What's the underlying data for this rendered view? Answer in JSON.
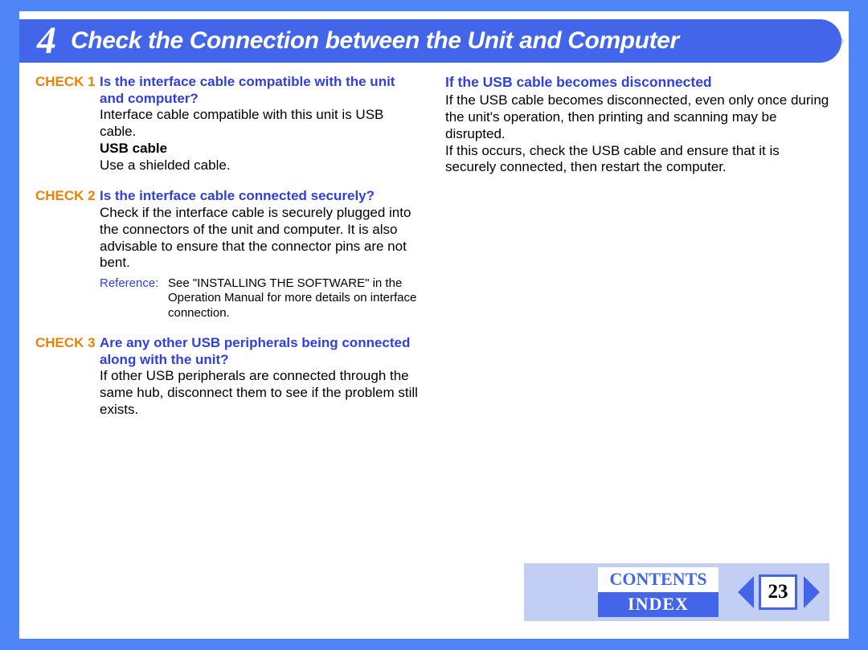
{
  "header": {
    "number": "4",
    "title": "Check the Connection between the Unit and Computer"
  },
  "left": {
    "c1": {
      "label": "CHECK 1",
      "q": "Is the interface cable compatible with the unit and computer?",
      "body1": "Interface cable compatible with this unit is USB cable.",
      "sub": "USB cable",
      "body2": "Use a shielded cable."
    },
    "c2": {
      "label": "CHECK 2",
      "q": "Is the interface cable connected securely?",
      "body": "Check if the interface cable is securely plugged into the connectors of the unit and computer. It is also advisable to ensure that the connector pins are not bent.",
      "ref_label": "Reference:",
      "ref_body": "See \"INSTALLING THE SOFTWARE\" in the Operation Manual for more details on interface connection."
    },
    "c3": {
      "label": "CHECK 3",
      "q": "Are any other USB peripherals being connected along with the unit?",
      "body": "If other USB peripherals are connected through the same hub, disconnect them to see if the problem still exists."
    }
  },
  "right": {
    "title": "If the USB cable becomes disconnected",
    "p1": "If the USB cable becomes disconnected, even only once during the unit's operation, then printing and scanning may be disrupted.",
    "p2": "If this occurs, check the USB cable and ensure that it is securely connected, then restart the computer."
  },
  "footer": {
    "contents": "CONTENTS",
    "index": "INDEX",
    "page": "23"
  }
}
